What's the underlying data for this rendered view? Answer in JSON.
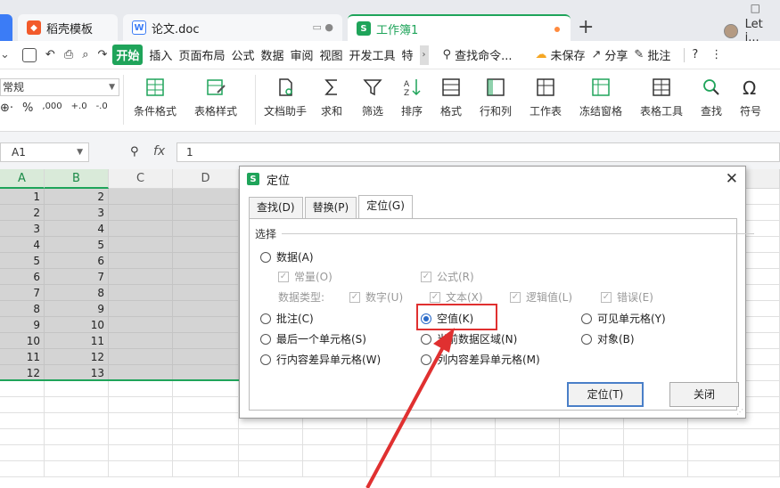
{
  "tabs": [
    {
      "label": "稻壳模板",
      "icon": "docer-icon"
    },
    {
      "label": "论文.doc",
      "icon": "word-icon"
    },
    {
      "label": "工作簿1",
      "icon": "sheet-icon"
    }
  ],
  "user": {
    "name": "Let i..."
  },
  "menu": {
    "items": [
      "开始",
      "插入",
      "页面布局",
      "公式",
      "数据",
      "审阅",
      "视图",
      "开发工具",
      "特"
    ],
    "search": "查找命令...",
    "unsaved": "未保存",
    "share": "分享",
    "comment": "批注"
  },
  "ribbon": {
    "number_format": "常规",
    "number_icons": [
      "⊕·",
      "%",
      ",000",
      "+.0",
      "-.0"
    ],
    "buttons": [
      "条件格式",
      "表格样式",
      "文档助手",
      "求和",
      "筛选",
      "排序",
      "格式",
      "行和列",
      "工作表",
      "冻结窗格",
      "表格工具",
      "查找",
      "符号"
    ]
  },
  "formula_bar": {
    "name_box": "A1",
    "fx": "fx",
    "value": "1"
  },
  "grid": {
    "columns": [
      "A",
      "B",
      "C",
      "D"
    ],
    "col_a": [
      "1",
      "2",
      "3",
      "4",
      "5",
      "6",
      "7",
      "8",
      "9",
      "10",
      "11",
      "12"
    ],
    "col_b": [
      "2",
      "3",
      "4",
      "5",
      "6",
      "7",
      "8",
      "9",
      "10",
      "11",
      "12",
      "13"
    ]
  },
  "dialog": {
    "title": "定位",
    "tabs": [
      "查找(D)",
      "替换(P)",
      "定位(G)"
    ],
    "group_label": "选择",
    "data_radio": "数据(A)",
    "checks_row1": [
      "常量(O)",
      "公式(R)"
    ],
    "data_type_label": "数据类型:",
    "checks_row2": [
      "数字(U)",
      "文本(X)",
      "逻辑值(L)",
      "错误(E)"
    ],
    "radios_col1": [
      "批注(C)",
      "最后一个单元格(S)",
      "行内容差异单元格(W)"
    ],
    "radios_col2": [
      "空值(K)",
      "当前数据区域(N)",
      "列内容差异单元格(M)"
    ],
    "radios_col3": [
      "可见单元格(Y)",
      "对象(B)"
    ],
    "ok_label": "定位(T)",
    "close_label": "关闭"
  },
  "colors": {
    "accent": "#1fa45a",
    "highlight": "#e03030",
    "radio": "#2a6ac8"
  }
}
